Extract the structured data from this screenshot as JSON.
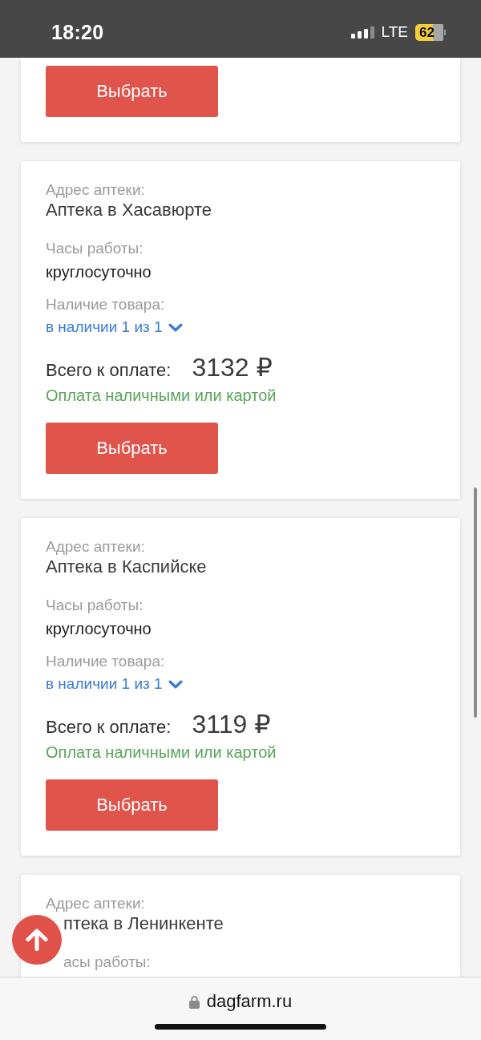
{
  "status_bar": {
    "time": "18:20",
    "network": "LTE",
    "battery": "62"
  },
  "cards": [
    {
      "button": "Выбрать"
    },
    {
      "address_label": "Адрес аптеки:",
      "address": "Аптека в Хасавюрте",
      "hours_label": "Часы работы:",
      "hours": "круглосуточно",
      "stock_label": "Наличие товара:",
      "stock": "в наличии 1 из 1",
      "stock_expanded": false,
      "total_label": "Всего к оплате:",
      "total": "3132 ₽",
      "payment": "Оплата наличными или картой",
      "button": "Выбрать"
    },
    {
      "address_label": "Адрес аптеки:",
      "address": "Аптека в Каспийске",
      "hours_label": "Часы работы:",
      "hours": "круглосуточно",
      "stock_label": "Наличие товара:",
      "stock": "в наличии 1 из 1",
      "stock_expanded": false,
      "total_label": "Всего к оплате:",
      "total": "3119 ₽",
      "payment": "Оплата наличными или картой",
      "button": "Выбрать"
    },
    {
      "address_label": "Адрес аптеки:",
      "address": "птека в Ленинкенте",
      "hours_label": "асы работы:"
    }
  ],
  "browser_bar": {
    "url": "dagfarm.ru"
  }
}
